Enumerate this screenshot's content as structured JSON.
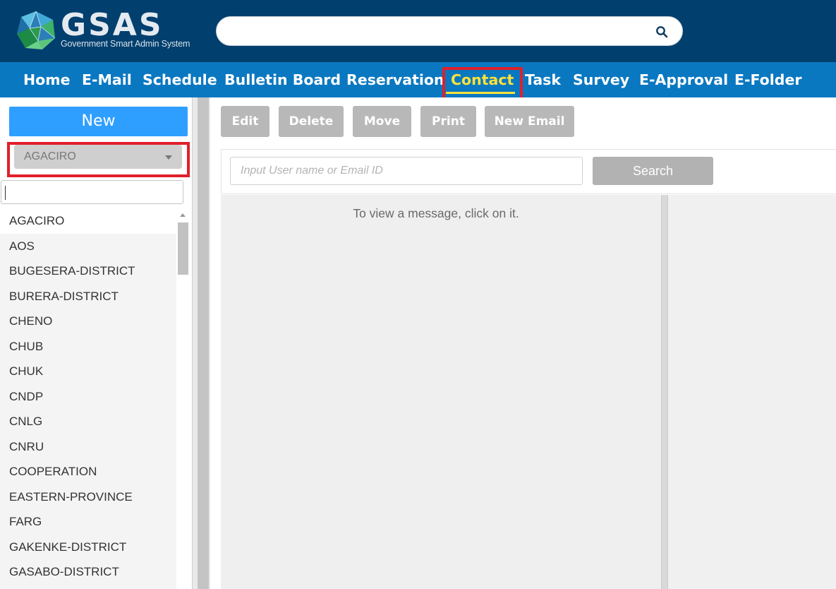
{
  "brand": {
    "name": "GSAS",
    "tagline": "Government Smart Admin System"
  },
  "header": {
    "search_placeholder": ""
  },
  "nav": {
    "items": [
      {
        "label": "Home"
      },
      {
        "label": "E-Mail"
      },
      {
        "label": "Schedule"
      },
      {
        "label": "Bulletin Board"
      },
      {
        "label": "Reservation"
      },
      {
        "label": "Contact",
        "active": true
      },
      {
        "label": "Task"
      },
      {
        "label": "Survey"
      },
      {
        "label": "E-Approval"
      },
      {
        "label": "E-Folder"
      }
    ]
  },
  "sidebar": {
    "new_label": "New",
    "selected_org": "AGACIRO",
    "filter_value": "",
    "orgs": [
      "AGACIRO",
      "AOS",
      "BUGESERA-DISTRICT",
      "BURERA-DISTRICT",
      "CHENO",
      "CHUB",
      "CHUK",
      "CNDP",
      "CNLG",
      "CNRU",
      "COOPERATION",
      "EASTERN-PROVINCE",
      "FARG",
      "GAKENKE-DISTRICT",
      "GASABO-DISTRICT"
    ]
  },
  "toolbar": {
    "edit": "Edit",
    "delete": "Delete",
    "move": "Move",
    "print": "Print",
    "new_email": "New Email"
  },
  "search": {
    "placeholder": "Input User name or Email ID",
    "button": "Search"
  },
  "content": {
    "empty_message": "To view a message, click on it."
  },
  "colors": {
    "header_bg": "#003f6e",
    "nav_bg": "#0a78c1",
    "active_nav": "#ffe23a",
    "new_button": "#2f9fff",
    "highlight": "#e0202a"
  }
}
